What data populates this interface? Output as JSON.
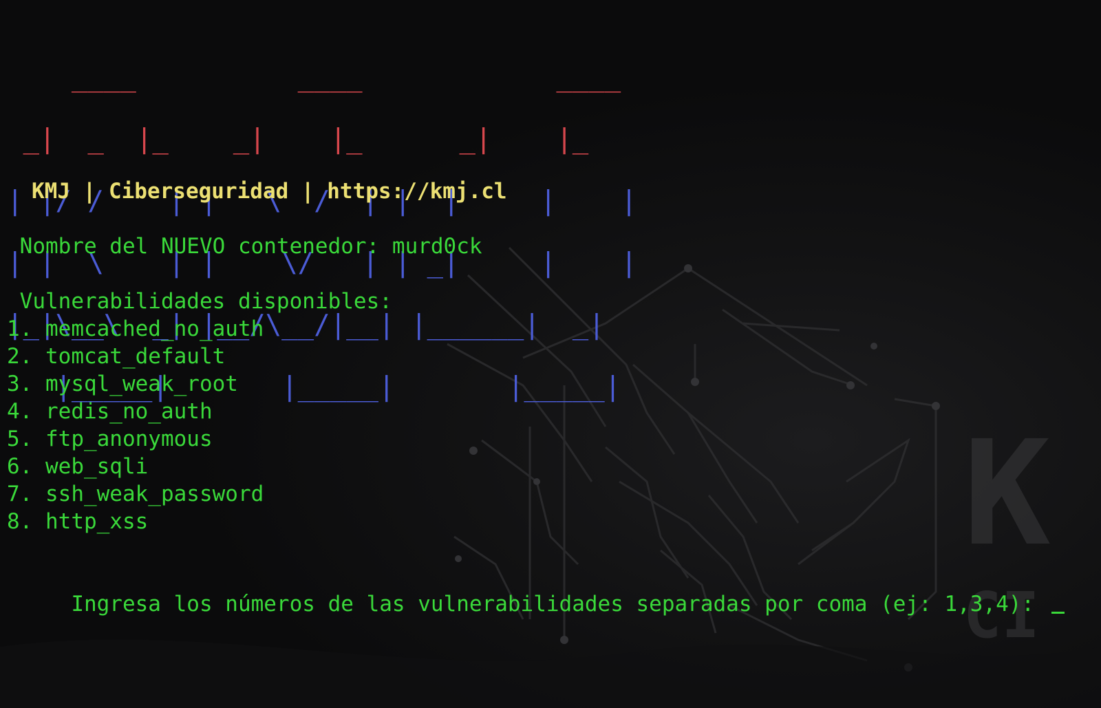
{
  "banner": {
    "rows": [
      {
        "red": "    ____          ____            ____",
        "blue": ""
      },
      {
        "red": " _|  _  |_    _|    |_      _|    |_",
        "blue": ""
      },
      {
        "red": "",
        "blue": "| |/ /    | |   \\  /  | |  |     |    |"
      },
      {
        "red": "",
        "blue": "| |  \\    | |    \\/   | | _|     |    |"
      },
      {
        "red": "",
        "blue": "|_|\\__\\  _| |__/\\__/|__| |______|  _|"
      },
      {
        "red": "",
        "blue": "   |_____|       |_____|       |_____|"
      }
    ]
  },
  "subtitle": "KMJ | Ciberseguridad | https://kmj.cl",
  "container_prompt": " Nombre del NUEVO contenedor: murd0ck",
  "vulns_heading": " Vulnerabilidades disponibles:",
  "vulnerabilities": [
    "1. memcached_no_auth",
    "2. tomcat_default",
    "3. mysql_weak_root",
    "4. redis_no_auth",
    "5. ftp_anonymous",
    "6. web_sqli",
    "7. ssh_weak_password",
    "8. http_xss"
  ],
  "input_prompt": " Ingresa los números de las vulnerabilidades separadas por coma (ej: 1,3,4): ",
  "watermark": {
    "line1": "K",
    "line2": "CI"
  },
  "colors": {
    "text_green": "#3ad93a",
    "subtitle_yellow": "#ece073",
    "banner_red": "#d8474d",
    "banner_blue": "#4b5cd6",
    "background": "#0d0d0e"
  }
}
